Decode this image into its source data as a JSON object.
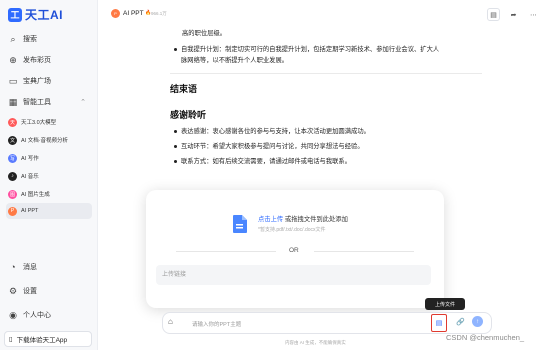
{
  "sidebar": {
    "logo": "天工AI",
    "nav": [
      {
        "label": "搜索",
        "icon": "search-icon"
      },
      {
        "label": "发布彩页",
        "icon": "add-icon"
      },
      {
        "label": "宝典广场",
        "icon": "book-icon"
      },
      {
        "label": "智能工具",
        "icon": "grid-icon"
      }
    ],
    "tools": [
      {
        "label": "天工3.0大模型",
        "color": "#ff5a5a"
      },
      {
        "label": "AI 文档·音视频分析",
        "color": "#222222"
      },
      {
        "label": "AI 写作",
        "color": "#5a7bff"
      },
      {
        "label": "AI 音乐",
        "color": "#222222"
      },
      {
        "label": "AI 图片生成",
        "color": "#ff4fa0"
      },
      {
        "label": "AI PPT",
        "color": "#ff7a45"
      }
    ],
    "bottom": [
      {
        "label": "消息",
        "icon": "bell-icon"
      },
      {
        "label": "设置",
        "icon": "gear-icon"
      },
      {
        "label": "个人中心",
        "icon": "user-icon"
      }
    ],
    "download_label": "下载体验天工App"
  },
  "header": {
    "title": "AI PPT",
    "count": "966.1万"
  },
  "doc": {
    "line0": "高的职位层级。",
    "line1": "自我提升计划：制定切实可行的自我提升计划，包括定期学习新技术、参加行业会议、扩大人",
    "line2": "脉网络等，以不断提升个人职业发展。",
    "h_end": "结束语",
    "h_thanks": "感谢聆听",
    "b1": "表达感谢：衷心感谢各位的参与与支持，让本次活动更加圆满成功。",
    "b2": "互动环节：希望大家积极参与提问与讨论，共同分享想法与经验。",
    "b3": "联系方式：如有后续交流需要，请通过邮件或电话与我联系。"
  },
  "upload": {
    "link_text": "点击上传",
    "rest_text": " 或拖拽文件到此处添加",
    "hint": "*暂支持.pdf/.txt/.doc/.docx文件",
    "or": "OR",
    "url_placeholder": "上传链接"
  },
  "input": {
    "placeholder": "请输入你的PPT主题",
    "tooltip": "上传文件"
  },
  "footer": "内容由 AI 生成，不能确保真实",
  "watermark": "CSDN @chenmuchen_"
}
